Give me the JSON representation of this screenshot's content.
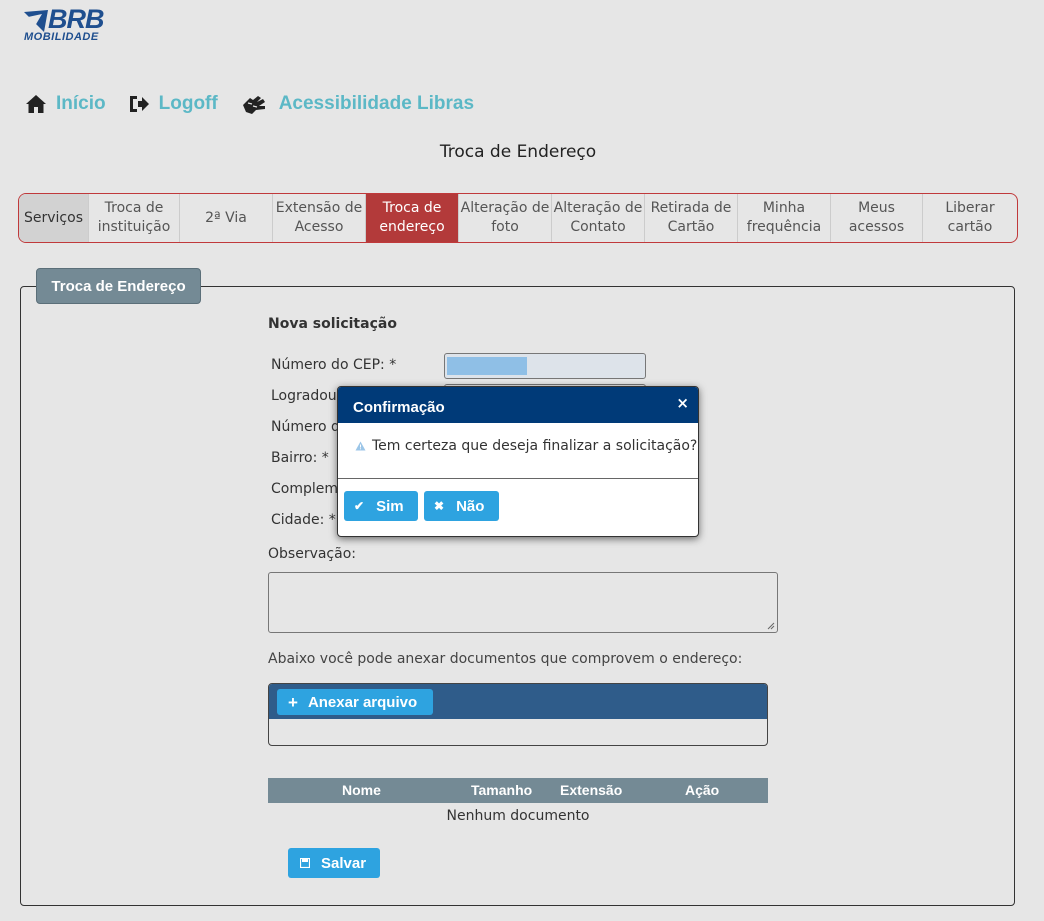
{
  "brand": {
    "name": "BRB",
    "subtitle": "MOBILIDADE",
    "color": "#1f4f8f"
  },
  "topnav": [
    {
      "icon": "home-icon",
      "label": "Início"
    },
    {
      "icon": "logoff-icon",
      "label": "Logoff"
    },
    {
      "icon": "sign-language-icon",
      "label": "Acessibilidade Libras"
    }
  ],
  "page_title": "Troca de Endereço",
  "tabs": [
    {
      "label": "Serviços"
    },
    {
      "label": "Troca de instituição"
    },
    {
      "label": "2ª Via"
    },
    {
      "label": "Extensão de Acesso"
    },
    {
      "label": "Troca de endereço",
      "active": true
    },
    {
      "label": "Alteração de foto"
    },
    {
      "label": "Alteração de Contato"
    },
    {
      "label": "Retirada de Cartão"
    },
    {
      "label": "Minha frequência"
    },
    {
      "label": "Meus acessos"
    },
    {
      "label": "Liberar cartão"
    }
  ],
  "panel": {
    "legend": "Troca de Endereço",
    "section_title": "Nova solicitação",
    "fields": {
      "cep": "Número do CEP:  *",
      "logradouro": "Logradouro",
      "numero": "Número d",
      "bairro": "Bairro:  *",
      "complemento": "Compleme",
      "cidade": "Cidade:  *"
    },
    "observacao_label": "Observação:",
    "attach_text": "Abaixo você pode anexar documentos que comprovem o endereço:",
    "attach_button": "Anexar arquivo",
    "table_headers": {
      "nome": "Nome",
      "tamanho": "Tamanho",
      "extensao": "Extensão",
      "acao": "Ação"
    },
    "empty_text": "Nenhum documento",
    "save_button": "Salvar"
  },
  "dialog": {
    "title": "Confirmação",
    "close": "×",
    "message": "Tem certeza que deseja finalizar a solicitação?",
    "yes": "Sim",
    "no": "Não"
  },
  "colors": {
    "accent": "#2ea3e0",
    "active_tab": "#b33a3a",
    "dialog_header": "#003a78",
    "nav_link": "#5cb8c6"
  }
}
